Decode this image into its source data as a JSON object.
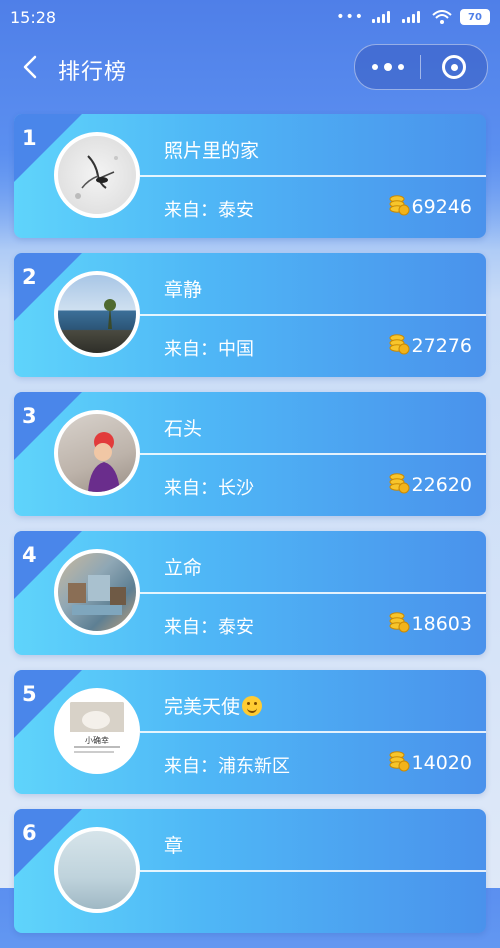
{
  "status": {
    "time": "15:28",
    "battery": "70"
  },
  "nav": {
    "title": "排行榜"
  },
  "colors": {
    "accent": "#4a86ea",
    "card_start": "#5fd4fb",
    "card_end": "#4a92ec",
    "coin": "#f2b31a"
  },
  "ranking": [
    {
      "rank": "1",
      "name": "照片里的家",
      "from": "来自：泰安",
      "score": "69246"
    },
    {
      "rank": "2",
      "name": "章静",
      "from": "来自：中国",
      "score": "27276"
    },
    {
      "rank": "3",
      "name": "石头",
      "from": "来自：长沙",
      "score": "22620"
    },
    {
      "rank": "4",
      "name": "立命",
      "from": "来自：泰安",
      "score": "18603"
    },
    {
      "rank": "5",
      "name": "完美天使",
      "from": "来自：浦东新区",
      "score": "14020"
    },
    {
      "rank": "6",
      "name": "章",
      "from": "",
      "score": ""
    }
  ],
  "avatar5_caption": "小确幸"
}
